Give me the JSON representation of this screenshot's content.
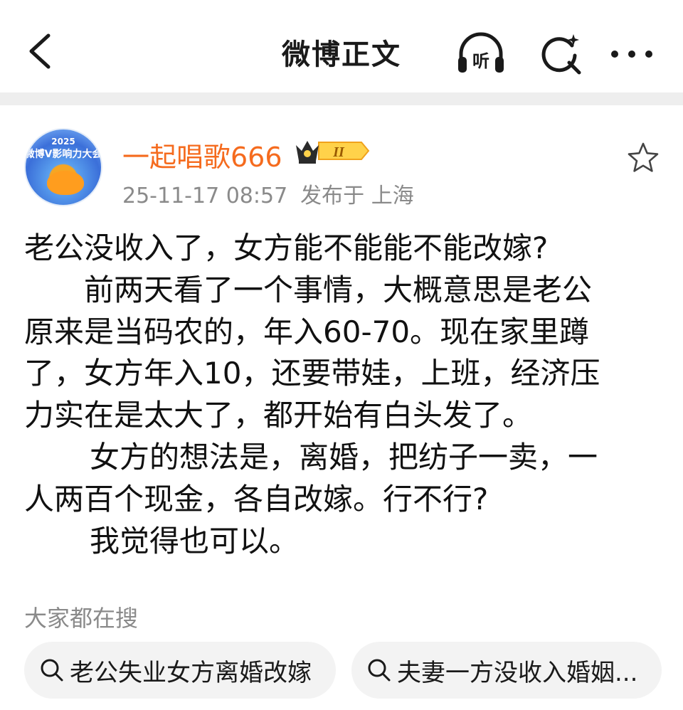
{
  "nav": {
    "title": "微博正文",
    "listen_label": "听"
  },
  "post": {
    "author": {
      "name": "一起唱歌666",
      "badge_level": "II",
      "avatar_year": "2025",
      "avatar_text": "微博V影响力大会"
    },
    "time": "25-11-17 08:57",
    "location": "发布于 上海",
    "body_lines": [
      "老公没收入了，女方能不能能不能改嫁?",
      "前两天看了一个事情，大概意思是老公",
      "原来是当码农的，年入60-70。现在家里蹲",
      "了，女方年入10，还要带娃，上班，经济压",
      "力实在是太大了，都开始有白头发了。",
      "女方的想法是，离婚，把纺子一卖，一",
      "人两百个现金，各自改嫁。行不行?",
      "我觉得也可以。"
    ]
  },
  "searches": {
    "title": "大家都在搜",
    "items": [
      "老公失业女方离婚改嫁",
      "夫妻一方没收入婚姻..."
    ]
  },
  "colors": {
    "username": "#f56b1e",
    "meta": "#8a8a8a",
    "divider": "#eeeeee",
    "chip_bg": "#f3f3f3"
  }
}
